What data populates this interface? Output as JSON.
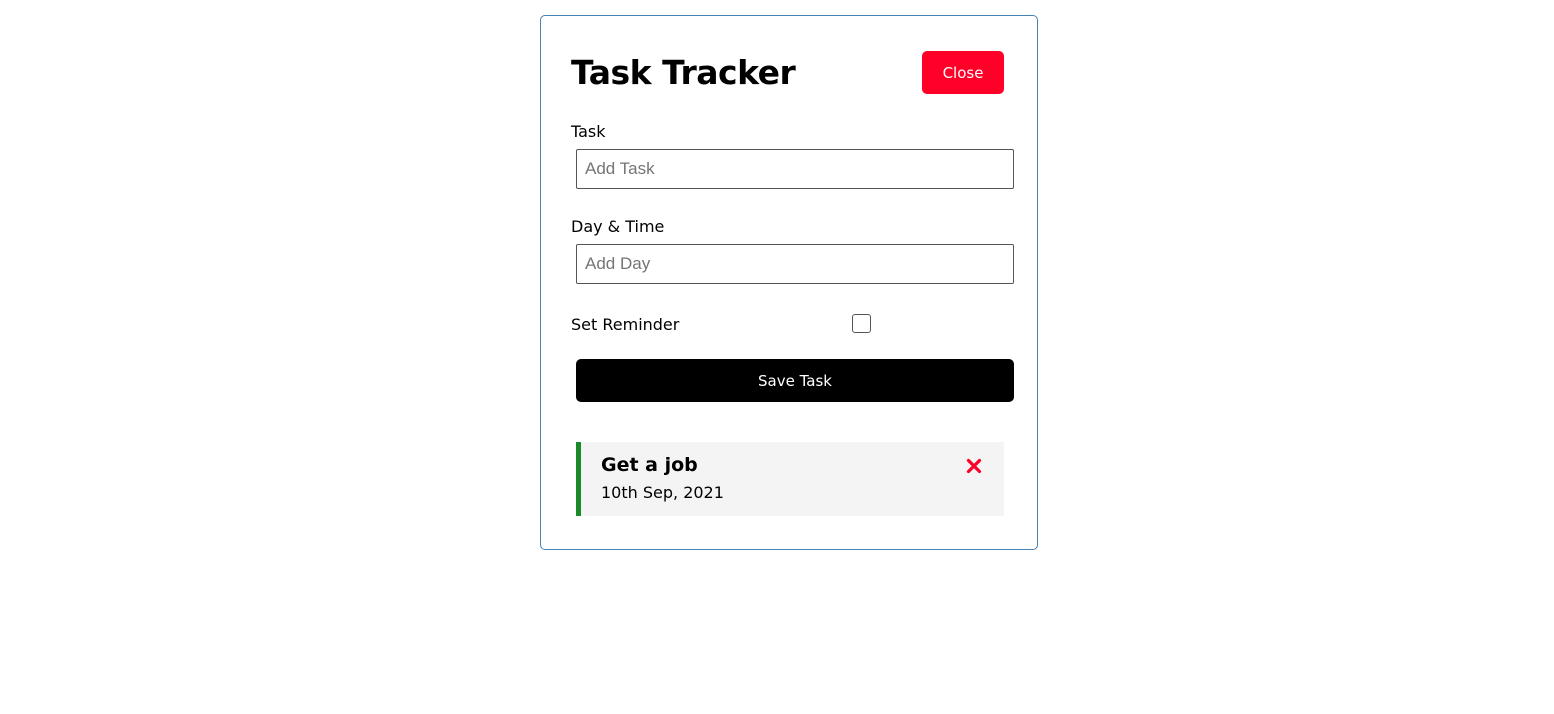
{
  "header": {
    "title": "Task Tracker",
    "close_label": "Close"
  },
  "form": {
    "task_label": "Task",
    "task_placeholder": "Add Task",
    "task_value": "",
    "day_label": "Day & Time",
    "day_placeholder": "Add Day",
    "day_value": "",
    "reminder_label": "Set Reminder",
    "reminder_checked": false,
    "save_label": "Save Task"
  },
  "tasks": [
    {
      "text": "Get a job",
      "day": "10th Sep, 2021",
      "reminder": true,
      "delete_icon": "times-icon"
    }
  ],
  "colors": {
    "close_button": "#ff0029",
    "save_button": "#000000",
    "reminder_border": "#1b8a2a",
    "delete_icon": "#ff0029",
    "task_background": "#f4f4f4",
    "container_border": "#4682b4"
  }
}
